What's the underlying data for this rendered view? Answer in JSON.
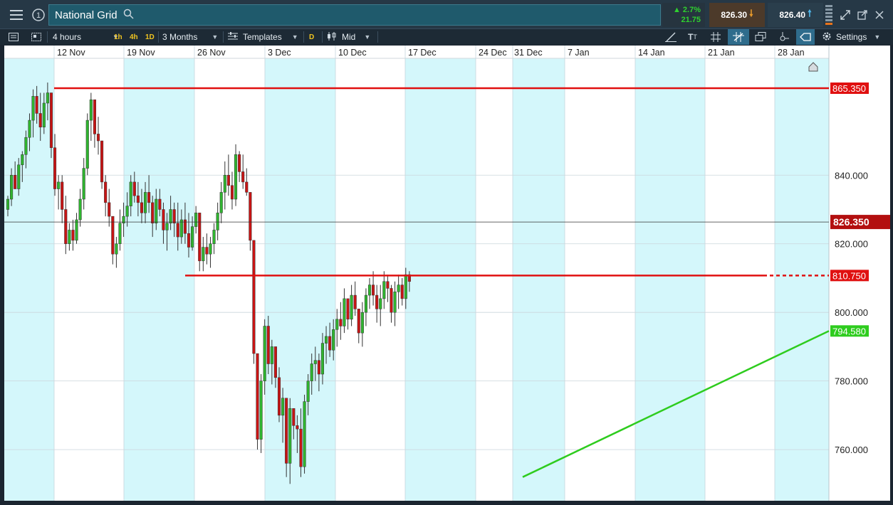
{
  "app": {
    "title": "National Grid"
  },
  "quote": {
    "change_pct": "▲ 2.7%",
    "change_abs": "21.75",
    "sell_price": "826.30",
    "buy_price": "826.40"
  },
  "toolbar": {
    "interval": "4 hours",
    "quick_intervals": [
      "1h",
      "4h",
      "1D"
    ],
    "range": "3 Months",
    "templates_label": "Templates",
    "d_tag": "D",
    "price_type": "Mid",
    "settings_label": "Settings"
  },
  "chart_data": {
    "type": "candlestick",
    "title": "",
    "x_tick_labels": [
      "12 Nov",
      "19 Nov",
      "26 Nov",
      "3 Dec",
      "10 Dec",
      "17 Dec",
      "24 Dec",
      "31 Dec",
      "7 Jan",
      "14 Jan",
      "21 Jan",
      "28 Jan"
    ],
    "y_tick_labels": [
      "840.000",
      "820.000",
      "800.000",
      "780.000",
      "760.000"
    ],
    "y_ticks": [
      840,
      820,
      800,
      780,
      760
    ],
    "ylim": [
      742,
      870
    ],
    "current_price_label": "826.350",
    "current_price": 826.35,
    "grid": true,
    "levels": [
      {
        "label": "865.350",
        "value": 865.35,
        "color": "#e01010"
      },
      {
        "label": "810.750",
        "value": 810.75,
        "color": "#e01010"
      },
      {
        "label": "794.580",
        "value": 794.58,
        "color": "#2ecc1e"
      }
    ],
    "trendline": {
      "from": {
        "date": "31 Dec",
        "value": 752
      },
      "to": {
        "date": "30 Jan",
        "value": 794.58
      },
      "color": "#2ecc1e"
    },
    "colors": {
      "up": "#2fb52f",
      "down": "#c81414",
      "band": "#d4f7fb"
    },
    "candles": [
      [
        830,
        834,
        828,
        833
      ],
      [
        833,
        842,
        831,
        840
      ],
      [
        840,
        844,
        836,
        836
      ],
      [
        836,
        845,
        834,
        843
      ],
      [
        843,
        847,
        838,
        846
      ],
      [
        846,
        853,
        842,
        851
      ],
      [
        851,
        858,
        847,
        856
      ],
      [
        856,
        865,
        851,
        863
      ],
      [
        863,
        866,
        855,
        858
      ],
      [
        858,
        864,
        850,
        854
      ],
      [
        854,
        864,
        852,
        861
      ],
      [
        861,
        867,
        856,
        864
      ],
      [
        864,
        860,
        845,
        848
      ],
      [
        848,
        852,
        834,
        836
      ],
      [
        836,
        840,
        830,
        838
      ],
      [
        838,
        840,
        826,
        830
      ],
      [
        830,
        834,
        817,
        820
      ],
      [
        820,
        826,
        818,
        824
      ],
      [
        824,
        827,
        818,
        821
      ],
      [
        821,
        829,
        820,
        827
      ],
      [
        827,
        836,
        825,
        833
      ],
      [
        833,
        845,
        830,
        842
      ],
      [
        842,
        858,
        840,
        856
      ],
      [
        856,
        864,
        850,
        862
      ],
      [
        862,
        860,
        848,
        852
      ],
      [
        852,
        857,
        846,
        850
      ],
      [
        850,
        844,
        836,
        838
      ],
      [
        838,
        840,
        828,
        832
      ],
      [
        832,
        836,
        825,
        828
      ],
      [
        828,
        827,
        814,
        817
      ],
      [
        817,
        822,
        813,
        820
      ],
      [
        820,
        830,
        818,
        826
      ],
      [
        826,
        832,
        822,
        828
      ],
      [
        828,
        835,
        825,
        831
      ],
      [
        831,
        840,
        828,
        838
      ],
      [
        838,
        841,
        832,
        834
      ],
      [
        834,
        838,
        828,
        832
      ],
      [
        832,
        836,
        826,
        829
      ],
      [
        829,
        838,
        826,
        835
      ],
      [
        835,
        840,
        829,
        832
      ],
      [
        832,
        834,
        822,
        826
      ],
      [
        826,
        836,
        824,
        833
      ],
      [
        833,
        836,
        828,
        830
      ],
      [
        830,
        832,
        820,
        824
      ],
      [
        824,
        829,
        818,
        826
      ],
      [
        826,
        834,
        824,
        830
      ],
      [
        830,
        832,
        822,
        826
      ],
      [
        826,
        832,
        818,
        822
      ],
      [
        822,
        830,
        820,
        827
      ],
      [
        827,
        832,
        820,
        823
      ],
      [
        823,
        829,
        816,
        819
      ],
      [
        819,
        828,
        818,
        825
      ],
      [
        825,
        831,
        823,
        829
      ],
      [
        829,
        825,
        812,
        815
      ],
      [
        815,
        822,
        812,
        819
      ],
      [
        819,
        823,
        814,
        817
      ],
      [
        817,
        822,
        813,
        820
      ],
      [
        820,
        826,
        817,
        824
      ],
      [
        824,
        832,
        821,
        829
      ],
      [
        829,
        838,
        826,
        835
      ],
      [
        835,
        844,
        830,
        840
      ],
      [
        840,
        846,
        834,
        837
      ],
      [
        837,
        841,
        830,
        833
      ],
      [
        833,
        849,
        831,
        846
      ],
      [
        846,
        847,
        838,
        841
      ],
      [
        841,
        846,
        836,
        838
      ],
      [
        838,
        842,
        834,
        835
      ],
      [
        835,
        832,
        818,
        821
      ],
      [
        821,
        799,
        785,
        788
      ],
      [
        788,
        779,
        760,
        763
      ],
      [
        763,
        782,
        759,
        780
      ],
      [
        780,
        798,
        776,
        796
      ],
      [
        796,
        799,
        782,
        785
      ],
      [
        785,
        792,
        779,
        790
      ],
      [
        790,
        788,
        778,
        781
      ],
      [
        781,
        784,
        768,
        770
      ],
      [
        770,
        778,
        762,
        775
      ],
      [
        775,
        772,
        752,
        756
      ],
      [
        756,
        775,
        750,
        772
      ],
      [
        772,
        771,
        763,
        767
      ],
      [
        767,
        770,
        759,
        766
      ],
      [
        766,
        772,
        752,
        755
      ],
      [
        755,
        776,
        753,
        774
      ],
      [
        774,
        782,
        770,
        780
      ],
      [
        780,
        788,
        776,
        785
      ],
      [
        785,
        790,
        780,
        786
      ],
      [
        786,
        788,
        777,
        782
      ],
      [
        782,
        794,
        779,
        791
      ],
      [
        791,
        796,
        785,
        793
      ],
      [
        793,
        797,
        787,
        789
      ],
      [
        789,
        798,
        786,
        795
      ],
      [
        795,
        801,
        790,
        798
      ],
      [
        798,
        803,
        792,
        796
      ],
      [
        796,
        807,
        794,
        804
      ],
      [
        804,
        802,
        795,
        798
      ],
      [
        798,
        808,
        796,
        805
      ],
      [
        805,
        809,
        799,
        801
      ],
      [
        801,
        799,
        791,
        794
      ],
      [
        794,
        803,
        790,
        800
      ],
      [
        800,
        807,
        796,
        805
      ],
      [
        805,
        810,
        801,
        808
      ],
      [
        808,
        812,
        802,
        805
      ],
      [
        805,
        808,
        797,
        801
      ],
      [
        801,
        808,
        796,
        804
      ],
      [
        804,
        812,
        801,
        809
      ],
      [
        809,
        811,
        803,
        807
      ],
      [
        807,
        808,
        797,
        800
      ],
      [
        800,
        809,
        796,
        806
      ],
      [
        806,
        811,
        801,
        808
      ],
      [
        808,
        810,
        802,
        804
      ],
      [
        804,
        813,
        801,
        811
      ],
      [
        811,
        812,
        806,
        809
      ]
    ]
  }
}
